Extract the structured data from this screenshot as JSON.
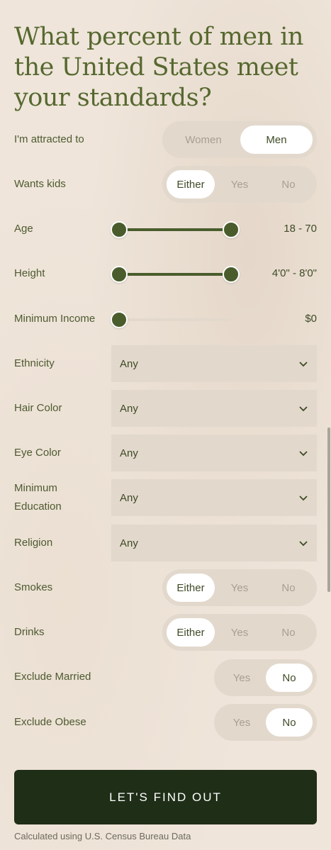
{
  "title": "What percent of men in the United States meet your standards?",
  "attracted": {
    "label": "I'm attracted to",
    "options": [
      "Women",
      "Men"
    ],
    "selected": "Men"
  },
  "wants_kids": {
    "label": "Wants kids",
    "options": [
      "Either",
      "Yes",
      "No"
    ],
    "selected": "Either"
  },
  "age": {
    "label": "Age",
    "value": "18 - 70",
    "low": 18,
    "high": 70
  },
  "height": {
    "label": "Height",
    "value": "4'0\" - 8'0\""
  },
  "income": {
    "label": "Minimum Income",
    "value": "$0",
    "fraction": 0
  },
  "ethnicity": {
    "label": "Ethnicity",
    "value": "Any"
  },
  "hair_color": {
    "label": "Hair Color",
    "value": "Any"
  },
  "eye_color": {
    "label": "Eye Color",
    "value": "Any"
  },
  "education": {
    "label_line1": "Minimum",
    "label_line2": "Education",
    "value": "Any"
  },
  "religion": {
    "label": "Religion",
    "value": "Any"
  },
  "smokes": {
    "label": "Smokes",
    "options": [
      "Either",
      "Yes",
      "No"
    ],
    "selected": "Either"
  },
  "drinks": {
    "label": "Drinks",
    "options": [
      "Either",
      "Yes",
      "No"
    ],
    "selected": "Either"
  },
  "exclude_married": {
    "label": "Exclude Married",
    "options": [
      "Yes",
      "No"
    ],
    "selected": "No"
  },
  "exclude_obese": {
    "label": "Exclude Obese",
    "options": [
      "Yes",
      "No"
    ],
    "selected": "No"
  },
  "cta_label": "LET'S FIND OUT",
  "footnote": "Calculated using U.S. Census Bureau Data",
  "colors": {
    "accent": "#4a5c2c",
    "cta": "#1f2e17",
    "background": "#efe5da"
  },
  "icons": {
    "dropdown": "chevron-down-icon"
  }
}
